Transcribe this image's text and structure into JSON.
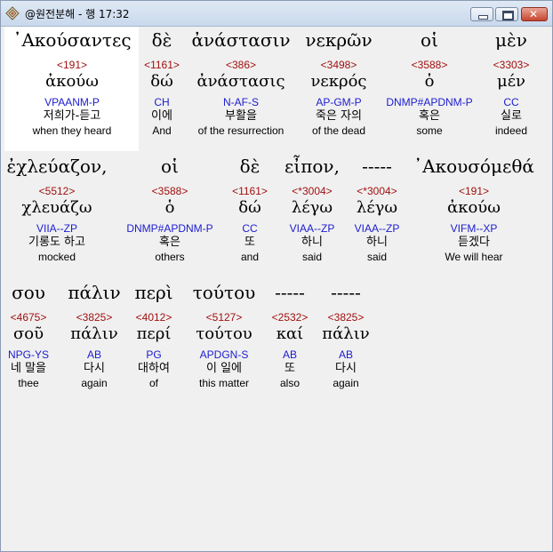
{
  "window": {
    "title": "@원전분해 - 행 17:32"
  },
  "words": [
    {
      "greek": "᾿Ακούσαντες",
      "strong": "<191>",
      "lemma": "ἀκούω",
      "parse": "VPAANM-P",
      "korean": "저희가-듣고",
      "english": "when they heard"
    },
    {
      "greek": "δὲ",
      "strong": "<1161>",
      "lemma": "δώ",
      "parse": "CH",
      "korean": "이에",
      "english": "And"
    },
    {
      "greek": "ἀνάστασιν",
      "strong": "<386>",
      "lemma": "ἀνάστασις",
      "parse": "N-AF-S",
      "korean": "부활을",
      "english": "of the resurrection"
    },
    {
      "greek": "νεκρῶν",
      "strong": "<3498>",
      "lemma": "νεκρός",
      "parse": "AP-GM-P",
      "korean": "죽은 자의",
      "english": "of the dead"
    },
    {
      "greek": "οἱ",
      "strong": "<3588>",
      "lemma": "ὁ",
      "parse": "DNMP#APDNM-P",
      "korean": "혹은",
      "english": "some"
    },
    {
      "greek": "μὲν",
      "strong": "<3303>",
      "lemma": "μέν",
      "parse": "CC",
      "korean": "실로",
      "english": "indeed"
    },
    {
      "greek": "ἐχλεύαζον,",
      "strong": "<5512>",
      "lemma": "χλευάζω",
      "parse": "VIIA--ZP",
      "korean": "기롱도 하고",
      "english": "mocked"
    },
    {
      "greek": "οἱ",
      "strong": "<3588>",
      "lemma": "ὁ",
      "parse": "DNMP#APDNM-P",
      "korean": "혹은",
      "english": "others"
    },
    {
      "greek": "δὲ",
      "strong": "<1161>",
      "lemma": "δώ",
      "parse": "CC",
      "korean": "또",
      "english": "and"
    },
    {
      "greek": "εἶπον,",
      "strong": "<*3004>",
      "lemma": "λέγω",
      "parse": "VIAA--ZP",
      "korean": "하니",
      "english": "said"
    },
    {
      "greek": "-----",
      "strong": "<*3004>",
      "lemma": "λέγω",
      "parse": "VIAA--ZP",
      "korean": "하니",
      "english": "said"
    },
    {
      "greek": "᾿Ακουσόμεθά",
      "strong": "<191>",
      "lemma": "ἀκούω",
      "parse": "VIFM--XP",
      "korean": "듣겠다",
      "english": "We will hear"
    },
    {
      "greek": "σου",
      "strong": "<4675>",
      "lemma": "σοῦ",
      "parse": "NPG-YS",
      "korean": "네 말을",
      "english": "thee"
    },
    {
      "greek": "πάλιν",
      "strong": "<3825>",
      "lemma": "πάλιν",
      "parse": "AB",
      "korean": "다시",
      "english": "again"
    },
    {
      "greek": "περὶ",
      "strong": "<4012>",
      "lemma": "περί",
      "parse": "PG",
      "korean": "대하여",
      "english": "of"
    },
    {
      "greek": "τούτου",
      "strong": "<5127>",
      "lemma": "τούτου",
      "parse": "APDGN-S",
      "korean": "이 일에",
      "english": "this matter"
    },
    {
      "greek": "-----",
      "strong": "<2532>",
      "lemma": "καί",
      "parse": "AB",
      "korean": "또",
      "english": "also"
    },
    {
      "greek": "-----",
      "strong": "<3825>",
      "lemma": "πάλιν",
      "parse": "AB",
      "korean": "다시",
      "english": "again"
    }
  ]
}
